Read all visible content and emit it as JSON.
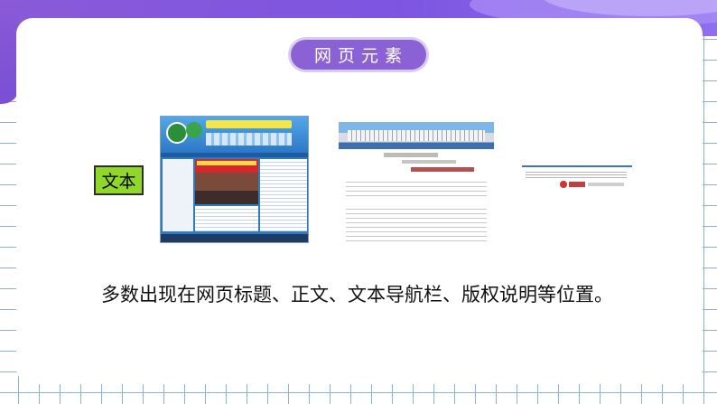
{
  "slide": {
    "title": "网页元素",
    "label": "文本",
    "description": "多数出现在网页标题、正文、文本导航栏、版权说明等位置。"
  },
  "colors": {
    "accent_purple": "#8b62d6",
    "label_green": "#8fd82a",
    "grid_blue": "#8fb0cf"
  },
  "images": [
    {
      "name": "school-homepage-screenshot"
    },
    {
      "name": "article-page-screenshot"
    },
    {
      "name": "copyright-footer-screenshot"
    }
  ]
}
